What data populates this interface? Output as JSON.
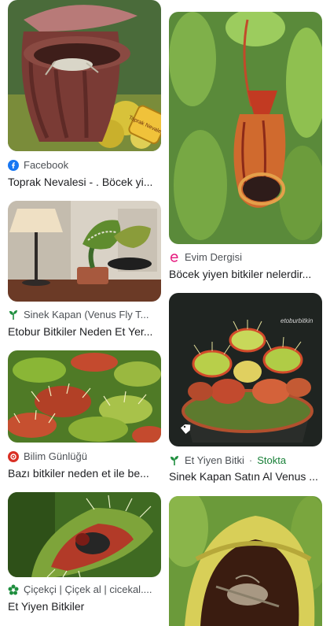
{
  "results": [
    {
      "source": "Facebook",
      "title": "Toprak Nevalesi - . Böcek yi...",
      "icon": "facebook-icon",
      "overlay": "Toprak Nevalesi"
    },
    {
      "source": "Evim Dergisi",
      "title": "Böcek yiyen bitkiler nelerdir...",
      "icon": "evim-dergisi-icon"
    },
    {
      "source": "Sinek Kapan (Venus Fly T...",
      "title": "Etobur Bitkiler Neden Et Yer...",
      "icon": "plant-icon"
    },
    {
      "source": "Bilim Günlüğü",
      "title": "Bazı bitkiler neden et ile be...",
      "icon": "bilim-gunlugu-icon"
    },
    {
      "source": "Et Yiyen Bitki",
      "stock": "Stokta",
      "title": "Sinek Kapan Satın Al Venus ...",
      "icon": "plant-icon",
      "watermark": "etoburbitkin"
    },
    {
      "source": "Çiçekçi | Çiçek al | cicekal....",
      "title": "Et Yiyen Bitkiler",
      "icon": "flower-icon"
    }
  ],
  "colors": {
    "facebook": "#1877f2",
    "evim": "#e5197e",
    "leaf": "#1e8e3e",
    "bilim": "#d93025",
    "stock": "#188038"
  }
}
